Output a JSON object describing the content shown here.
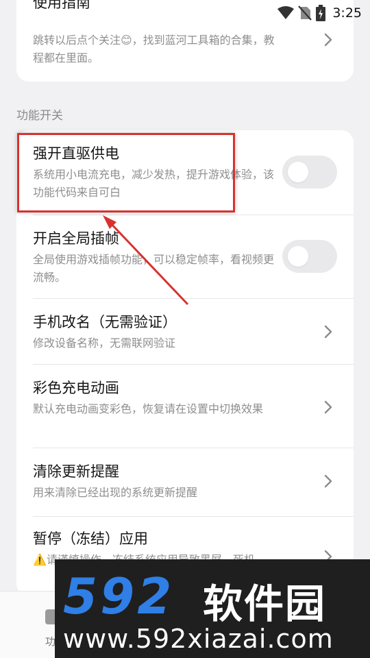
{
  "status_bar": {
    "time": "3:25",
    "icons": [
      "wifi-icon",
      "no-sim-icon",
      "battery-charging-icon"
    ]
  },
  "top_card": {
    "title": "使用指南",
    "desc": "跳转以后点个关注😊，找到蓝河工具箱的合集，教程都在里面。"
  },
  "section_label": "功能开关",
  "settings": [
    {
      "title": "强开直驱供电",
      "desc": "系统用小电流充电，减少发热，提升游戏体验，该功能代码来自可白",
      "control": "toggle",
      "enabled": false
    },
    {
      "title": "开启全局插帧",
      "desc": "全局使用游戏插帧功能，可以稳定帧率，看视频更流畅。",
      "control": "toggle",
      "enabled": false
    },
    {
      "title": "手机改名（无需验证）",
      "desc": "修改设备名称，无需联网验证",
      "control": "chevron"
    },
    {
      "title": "彩色充电动画",
      "desc": "默认充电动画变彩色，恢复请在设置中切换效果",
      "control": "chevron"
    },
    {
      "title": "清除更新提醒",
      "desc": "用来清除已经出现的系统更新提醒",
      "control": "chevron"
    },
    {
      "title": "暂停（冻结）应用",
      "desc": "⚠️请谨慎操作，冻结系统应用导致黑屏、死机、",
      "control": "chevron"
    }
  ],
  "bottom_nav": {
    "first_label": "功"
  },
  "watermark": {
    "logo_number": "592",
    "logo_cn": "软件园",
    "url": "www.592xiazai.com"
  },
  "colors": {
    "annotation": "#d8322f",
    "watermark_blue": "#2f7fe6"
  }
}
